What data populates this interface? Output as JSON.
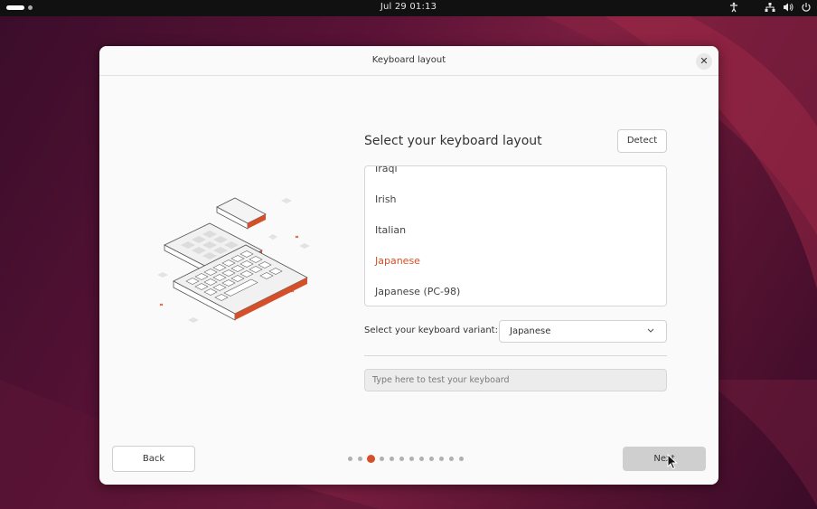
{
  "topbar": {
    "clock": "Jul 29  01:13",
    "tray_icons": [
      "accessibility-icon",
      "network-icon",
      "volume-icon",
      "power-icon"
    ]
  },
  "dialog": {
    "title": "Keyboard layout",
    "heading": "Select your keyboard layout",
    "detect_label": "Detect",
    "layouts": [
      {
        "label": "Iraqi",
        "selected": false
      },
      {
        "label": "Irish",
        "selected": false
      },
      {
        "label": "Italian",
        "selected": false
      },
      {
        "label": "Japanese",
        "selected": true
      },
      {
        "label": "Japanese (PC-98)",
        "selected": false
      }
    ],
    "variant_label": "Select your keyboard variant:",
    "variant_value": "Japanese",
    "test_placeholder": "Type here to test your keyboard",
    "back_label": "Back",
    "next_label": "Next",
    "pager": {
      "total": 12,
      "current": 3
    }
  },
  "colors": {
    "accent": "#d4502a",
    "topbar": "#111111",
    "dialog_bg": "#fafafa"
  }
}
